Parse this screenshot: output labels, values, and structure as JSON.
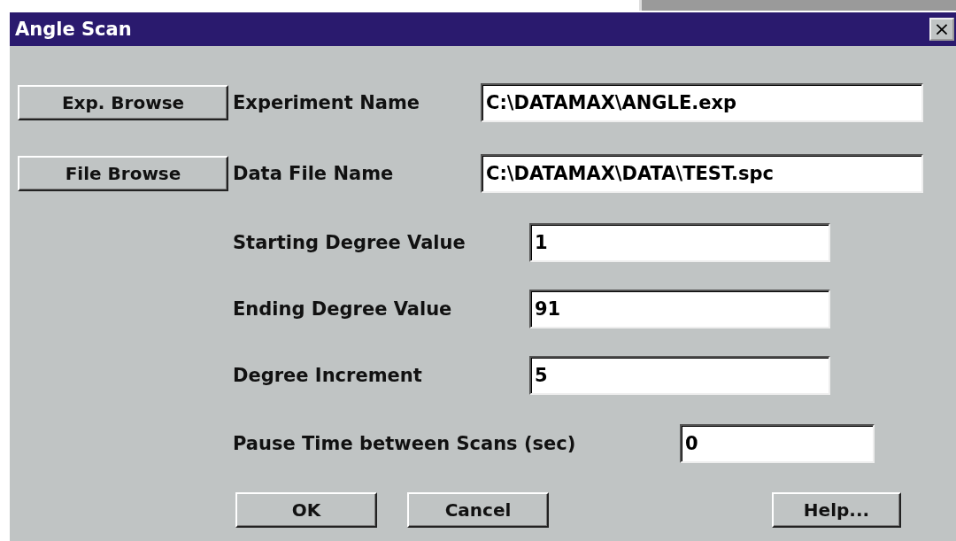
{
  "window": {
    "title": "Angle Scan",
    "close": "×"
  },
  "browse_buttons": [
    {
      "label": "Exp. Browse"
    },
    {
      "label": "File Browse"
    }
  ],
  "fields": [
    {
      "kind": "wide",
      "label": "Experiment Name",
      "value": "C:\\DATAMAX\\ANGLE.exp"
    },
    {
      "kind": "wide",
      "label": "Data File Name",
      "value": "C:\\DATAMAX\\DATA\\TEST.spc"
    },
    {
      "kind": "mid",
      "label": "Starting Degree Value",
      "value": "1"
    },
    {
      "kind": "mid",
      "label": "Ending Degree Value",
      "value": "91"
    },
    {
      "kind": "mid",
      "label": "Degree Increment",
      "value": "5"
    },
    {
      "kind": "short",
      "label": "Pause Time between Scans (sec)",
      "value": "0"
    }
  ],
  "buttons": [
    {
      "label": "OK"
    },
    {
      "label": "Cancel"
    },
    {
      "label": "Help..."
    }
  ]
}
